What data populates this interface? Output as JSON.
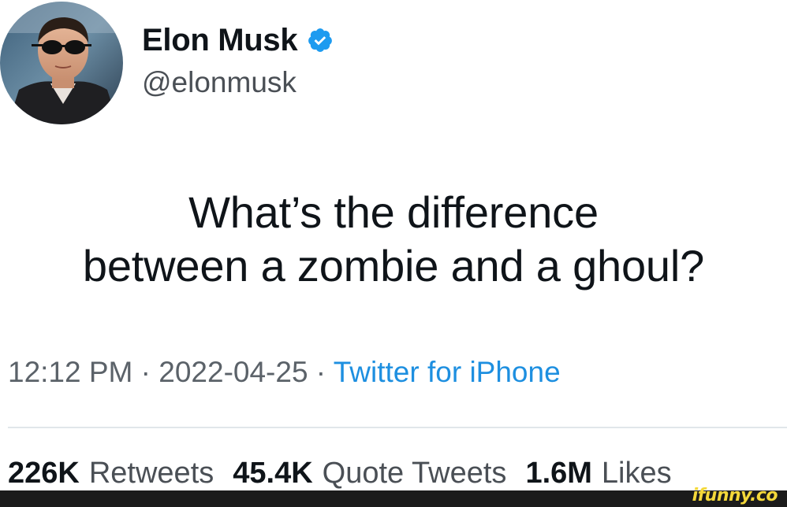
{
  "author": {
    "display_name": "Elon Musk",
    "handle": "@elonmusk",
    "verified_icon": "verified-badge-icon",
    "avatar": "profile-photo-man-sunglasses"
  },
  "tweet": {
    "lines": [
      "What’s the difference",
      "between a zombie and a ghoul?"
    ]
  },
  "meta": {
    "time": "12:12 PM",
    "separator": " · ",
    "date": "2022-04-25",
    "source": "Twitter for iPhone"
  },
  "stats": {
    "retweets_count": "226K",
    "retweets_label": "Retweets",
    "quotes_count": "45.4K",
    "quotes_label": "Quote Tweets",
    "likes_count": "1.6M",
    "likes_label": "Likes"
  },
  "watermark": {
    "text": "ifunny.co"
  },
  "colors": {
    "text_primary": "#0f1419",
    "text_secondary": "#5b6269",
    "link_blue": "#1d8fe0",
    "verified_blue": "#1d9bf0",
    "watermark_yellow": "#f4d83a"
  }
}
